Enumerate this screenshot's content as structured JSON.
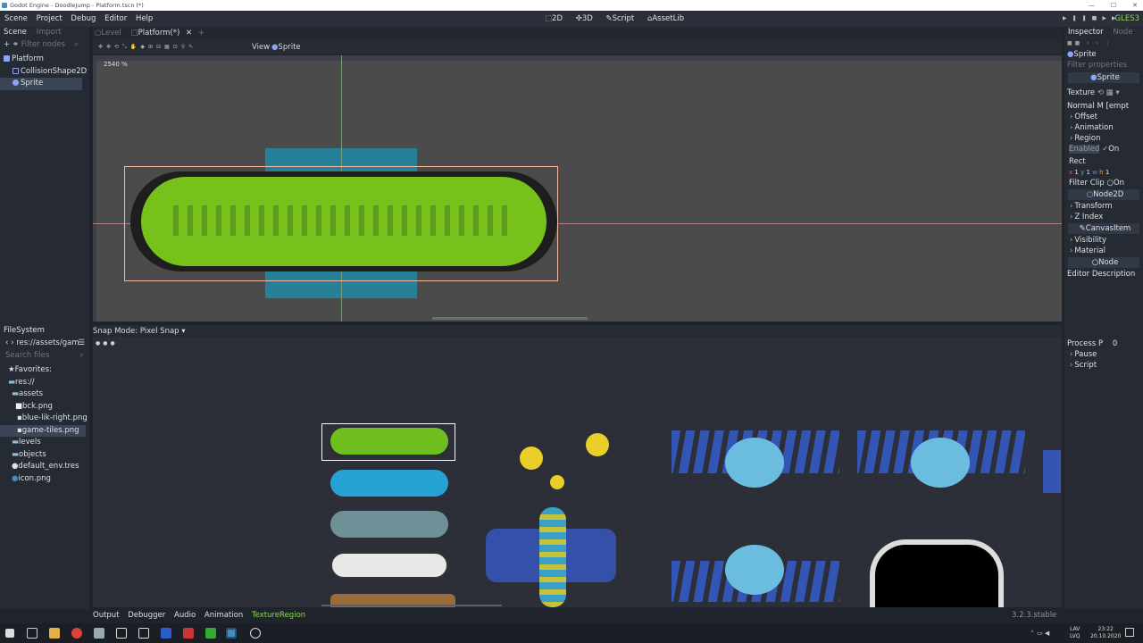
{
  "window": {
    "title": "Godot Engine - DoodleJump - Platform.tscn (*)"
  },
  "menu": {
    "items": [
      "Scene",
      "Project",
      "Debug",
      "Editor",
      "Help"
    ]
  },
  "workspaces": {
    "items": [
      "2D",
      "3D",
      "Script",
      "AssetLib"
    ],
    "active": "2D"
  },
  "renderer": "GLES3",
  "scene_dock": {
    "tabs": [
      "Scene",
      "Import"
    ],
    "filter_placeholder": "Filter nodes",
    "nodes": [
      "Platform",
      "CollisionShape2D",
      "Sprite"
    ],
    "selected": "Sprite"
  },
  "scene_tabs": [
    "Level",
    "Platform(*)"
  ],
  "viewport_toolbar": {
    "view_label": "View",
    "sprite_label": "Sprite"
  },
  "viewport": {
    "zoom": "2540 %"
  },
  "filesystem": {
    "title": "FileSystem",
    "path": "res://assets/gam",
    "search_placeholder": "Search files",
    "items": [
      "Favorites:",
      "res://",
      "assets",
      "bck.png",
      "blue-lik-right.png",
      "game-tiles.png",
      "levels",
      "objects",
      "default_env.tres",
      "icon.png"
    ],
    "selected": "game-tiles.png"
  },
  "texture_region": {
    "snap_label": "Snap Mode:",
    "snap_value": "Pixel Snap"
  },
  "bottom_tabs": [
    "Output",
    "Debugger",
    "Audio",
    "Animation",
    "TextureRegion"
  ],
  "version": "3.2.3.stable",
  "inspector": {
    "tabs": [
      "Inspector",
      "Node"
    ],
    "node_name": "Sprite",
    "filter_placeholder": "Filter properties",
    "class_header": "Sprite",
    "texture_label": "Texture",
    "normal_map_label": "Normal M",
    "normal_map_value": "[empt",
    "sections_1": [
      "Offset",
      "Animation",
      "Region"
    ],
    "enabled_label": "Enabled",
    "enabled_value": "On",
    "rect_label": "Rect",
    "rect_x": "1",
    "rect_y": "1",
    "rect_h": "1",
    "filter_clip_label": "Filter Clip",
    "filter_clip_value": "On",
    "node2d_header": "Node2D",
    "sections_2": [
      "Transform",
      "Z Index"
    ],
    "canvas_header": "CanvasItem",
    "sections_3": [
      "Visibility",
      "Material"
    ],
    "node_header": "Node",
    "editor_description": "Editor Description",
    "process_label": "Process P",
    "process_value": "0",
    "sections_4": [
      "Pause",
      "Script"
    ]
  },
  "tray": {
    "lang": "LAV",
    "lang2": "LVQ",
    "time": "23:22",
    "date": "20.10.2020"
  },
  "colors": {
    "accent": "#8fd65b",
    "platform_green": "#76c21a",
    "collision_blue": "#1e8aa6"
  }
}
